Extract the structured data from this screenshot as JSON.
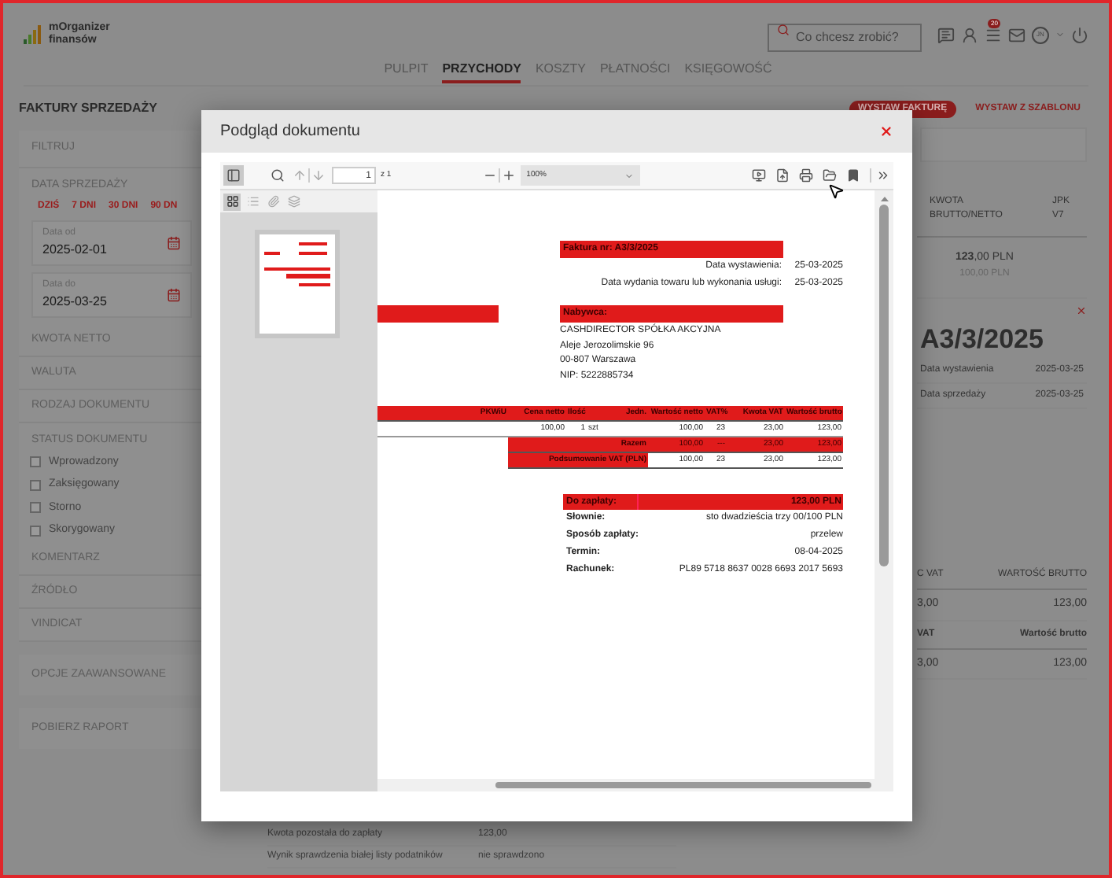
{
  "app": {
    "logo_lines": [
      "mOrganizer",
      "finansów"
    ],
    "search": {
      "placeholder": "Co chcesz zrobić?"
    },
    "badge": "20",
    "avatar": "JN"
  },
  "nav": [
    {
      "label": "PULPIT",
      "selected": false
    },
    {
      "label": "PRZYCHODY",
      "selected": true
    },
    {
      "label": "KOSZTY",
      "selected": false
    },
    {
      "label": "PŁATNOŚCI",
      "selected": false
    },
    {
      "label": "KSIĘGOWOŚĆ",
      "selected": false
    }
  ],
  "page_title": "FAKTURY SPRZEDAŻY",
  "actions": [
    {
      "label": "WYSTAW FAKTURĘ",
      "kind": "filled"
    },
    {
      "label": "WYSTAW Z SZABLONU",
      "kind": "text"
    }
  ],
  "filters": {
    "title": "FILTRUJ",
    "date_section": "DATA SPRZEDAŻY",
    "quick_ranges": [
      "DZIŚ",
      "7 DNI",
      "30 DNI",
      "90 DN"
    ],
    "date_fields": [
      {
        "label": "Data od",
        "value": "2025-02-01"
      },
      {
        "label": "Data do",
        "value": "2025-03-25"
      }
    ],
    "sections_before": [
      "KWOTA NETTO",
      "WALUTA",
      "RODZAJ DOKUMENTU"
    ],
    "status": {
      "title": "STATUS DOKUMENTU",
      "options": [
        {
          "label": "Wprowadzony",
          "checked": false
        },
        {
          "label": "Zaksięgowany",
          "checked": false
        },
        {
          "label": "Storno",
          "checked": false
        },
        {
          "label": "Skorygowany",
          "checked": false
        }
      ]
    },
    "sections_after": [
      "KOMENTARZ",
      "ŹRÓDŁO",
      "VINDICAT"
    ],
    "extra_panels": [
      "OPCJE ZAAWANSOWANE",
      "POBIERZ RAPORT"
    ]
  },
  "list": {
    "columns": [
      "KWOTA BRUTTO/NETTO",
      "JPK V7"
    ],
    "gross": "**123**,00 PLN",
    "net": "100,00 PLN"
  },
  "detail": {
    "number": "A3/3/2025",
    "fields": [
      {
        "label": "Data wystawienia",
        "value": "2025-03-25"
      },
      {
        "label": "Data sprzedaży",
        "value": "2025-03-25"
      }
    ],
    "tables": [
      {
        "columns": [
          "C VAT",
          "WARTOŚĆ BRUTTO"
        ],
        "values": [
          "3,00",
          "123,00"
        ]
      },
      {
        "columns": [
          "VAT",
          "Wartość brutto"
        ],
        "values": [
          "3,00",
          "123,00"
        ]
      }
    ],
    "summary": [
      {
        "label": "Kwota pozostała do zapłaty",
        "value": "123,00"
      },
      {
        "label": "Wynik sprawdzenia białej listy podatników",
        "value": "nie sprawdzono"
      }
    ]
  },
  "modal": {
    "title": "Podgląd dokumentu",
    "sidebar_open": true,
    "page": "1",
    "page_count": "z 1",
    "zoom": "100%",
    "sidebar_tabs": [
      {
        "kind": "thumbnails",
        "selected": true
      },
      {
        "kind": "outline",
        "selected": false
      },
      {
        "kind": "attachments",
        "selected": false
      },
      {
        "kind": "layers",
        "selected": false
      }
    ],
    "document": {
      "invoice_title": "Faktura nr: A3/3/2025",
      "dates": [
        {
          "label": "Data wystawienia:",
          "value": "25-03-2025"
        },
        {
          "label": "Data wydania towaru lub wykonania usługi:",
          "value": "25-03-2025"
        }
      ],
      "buyer": {
        "heading": "Nabywca:",
        "lines": [
          "CASHDIRECTOR SPÓŁKA AKCYJNA",
          "Aleje Jerozolimskie 96",
          "00-807 Warszawa",
          "NIP: 5222885734"
        ]
      },
      "table": {
        "columns": [
          "PKWiU",
          "Cena netto",
          "Ilość",
          "Jedn.",
          "Wartość netto",
          "VAT%",
          "Kwota VAT",
          "Wartość brutto"
        ],
        "rows": [
          {
            "cells": [
              "",
              "100,00",
              "1",
              "szt",
              "100,00",
              "23",
              "23,00",
              "123,00"
            ]
          }
        ],
        "totals": [
          {
            "label": "Razem",
            "cells": [
              "100,00",
              "---",
              "23,00",
              "123,00"
            ],
            "kind": "filled"
          },
          {
            "label": "Podsumowanie VAT (PLN)",
            "cells": [
              "100,00",
              "23",
              "23,00",
              "123,00"
            ],
            "kind": "plain"
          }
        ]
      },
      "due": {
        "label": "Do zapłaty:",
        "value": "123,00 PLN"
      },
      "payment": [
        {
          "label": "Słownie:",
          "value": "sto dwadzieścia trzy 00/100 PLN"
        },
        {
          "label": "Sposób zapłaty:",
          "value": "przelew"
        },
        {
          "label": "Termin:",
          "value": "08-04-2025"
        },
        {
          "label": "Rachunek:",
          "value": "PL89 5718 8637 0028 6693 2017 5693"
        }
      ]
    }
  }
}
